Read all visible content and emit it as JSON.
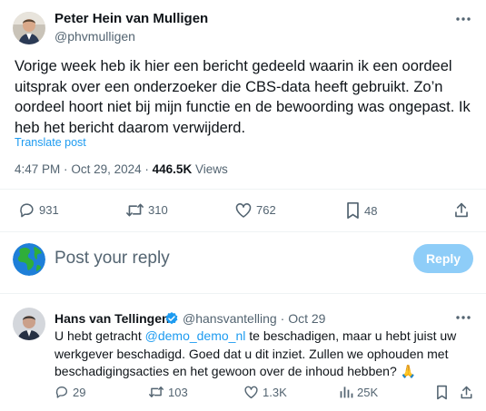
{
  "main_tweet": {
    "author_name": "Peter Hein van Mulligen",
    "author_handle": "@phvmulligen",
    "text": "Vorige week heb ik hier een bericht gedeeld waarin ik een oordeel uitsprak over een onderzoeker die CBS-data heeft gebruikt. Zo’n oordeel hoort niet bij mijn functie en de bewoording was ongepast. Ik heb het bericht daarom verwijderd.",
    "translate_label": "Translate post",
    "time": "4:47 PM",
    "separator": "·",
    "date": "Oct 29, 2024",
    "views_count": "446.5K",
    "views_label": "Views",
    "actions": {
      "replies": "931",
      "reposts": "310",
      "likes": "762",
      "bookmarks": "48"
    }
  },
  "composer": {
    "placeholder": "Post your reply",
    "reply_button": "Reply"
  },
  "reply": {
    "author_name": "Hans van Tellingen",
    "handle": "@hansvantelling",
    "separator": "·",
    "date": "Oct 29",
    "text_before_mention": "U hebt getracht ",
    "mention": "@demo_demo_nl",
    "text_after_mention": " te beschadigen, maar u hebt juist uw werkgever beschadigd. Goed dat u dit inziet. Zullen we ophouden met beschadigingsacties en het gewoon over de inhoud hebben? 🙏",
    "actions": {
      "replies": "29",
      "reposts": "103",
      "likes": "1.3K",
      "views": "25K"
    }
  },
  "colors": {
    "accent": "#1d9bf0",
    "reply_button_disabled": "#8ecdf8",
    "muted_text": "#536471",
    "divider": "#eff3f4"
  },
  "icons": {
    "more": "more-horizontal-icon",
    "reply": "reply-icon",
    "repost": "repost-icon",
    "like": "heart-icon",
    "bookmark": "bookmark-icon",
    "share": "share-icon",
    "views": "views-icon",
    "verified": "verified-badge-icon",
    "globe": "globe-avatar-icon"
  }
}
